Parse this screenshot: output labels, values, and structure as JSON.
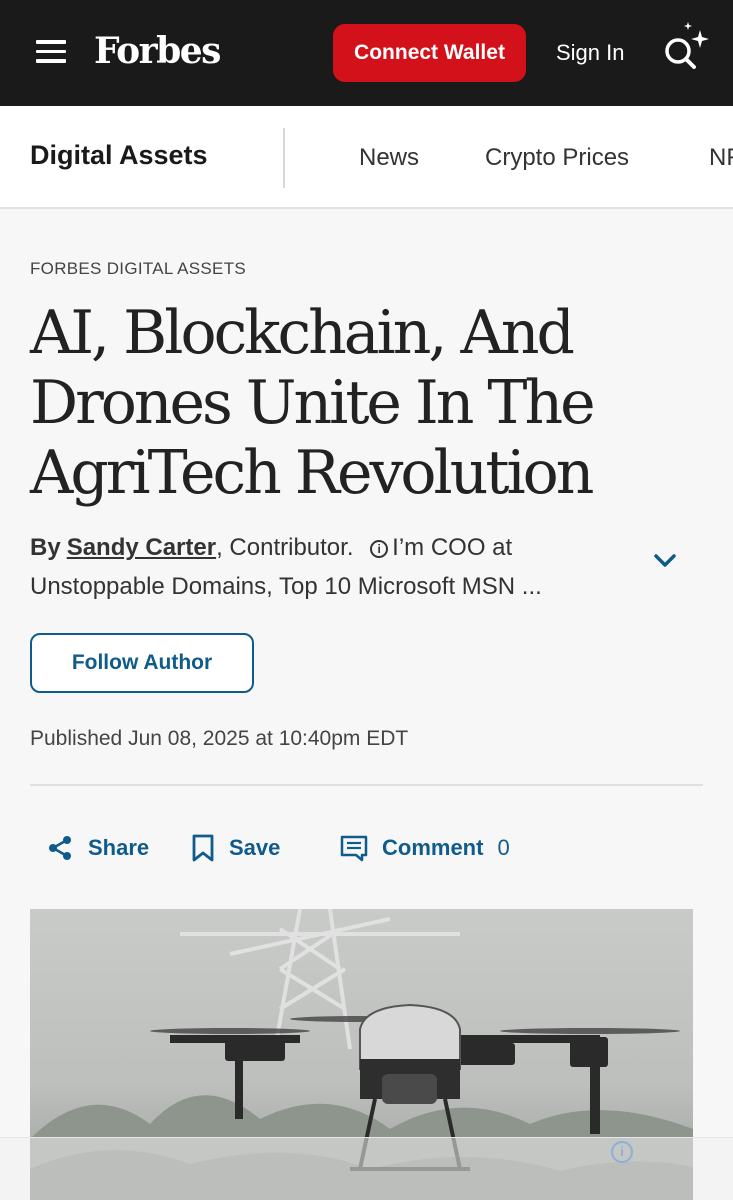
{
  "header": {
    "logo": "Forbes",
    "connect_wallet_label": "Connect Wallet",
    "sign_in_label": "Sign In"
  },
  "subnav": {
    "section_title": "Digital Assets",
    "items": [
      {
        "label": "News"
      },
      {
        "label": "Crypto Prices"
      },
      {
        "label": "NFTs"
      }
    ]
  },
  "article": {
    "kicker": "FORBES DIGITAL ASSETS",
    "headline": "AI, Blockchain, And Drones Unite In The AgriTech Revolution",
    "byline": {
      "by_label": "By",
      "author": "Sandy Carter",
      "role": "Contributor.",
      "bio": "I’m COO at Unstoppable Domains, Top 10 Microsoft MSN ..."
    },
    "follow_label": "Follow Author",
    "published": "Published Jun 08, 2025 at 10:40pm EDT"
  },
  "actions": {
    "share_label": "Share",
    "save_label": "Save",
    "comment_label": "Comment",
    "comment_count": "0"
  },
  "colors": {
    "header_bg": "#1a1a1a",
    "brand_red": "#d3111b",
    "link_blue": "#0f5c8c"
  },
  "icons": [
    "hamburger-menu-icon",
    "search-sparkle-icon",
    "info-icon",
    "chevron-down-icon",
    "share-icon",
    "bookmark-icon",
    "comment-icon",
    "ad-info-icon"
  ]
}
